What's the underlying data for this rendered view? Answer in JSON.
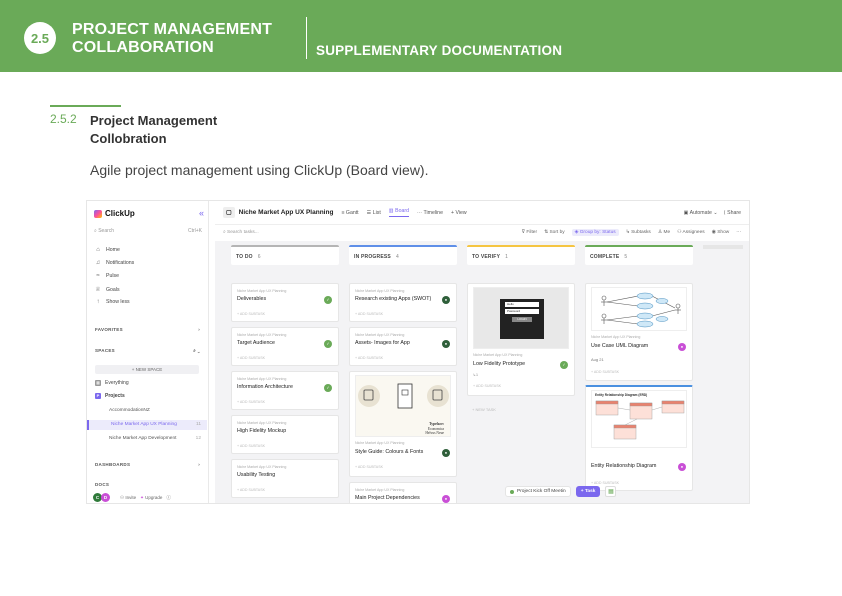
{
  "header": {
    "section_number": "2.5",
    "title_line1": "PROJECT MANAGEMENT",
    "title_line2": "COLLABORATION",
    "subtitle": "SUPPLEMENTARY DOCUMENTATION"
  },
  "subsection": {
    "number": "2.5.2",
    "title_line1": "Project Management",
    "title_line2": "Collobration",
    "description": "Agile project management using ClickUp (Board view)."
  },
  "colors": {
    "accent_green": "#6aaa58",
    "clickup_purple": "#7b68ee"
  },
  "clickup": {
    "sidebar": {
      "logo": "ClickUp",
      "search_placeholder": "Search",
      "search_shortcut": "Ctrl+K",
      "nav": [
        {
          "icon": "home-icon",
          "label": "Home"
        },
        {
          "icon": "bell-icon",
          "label": "Notifications"
        },
        {
          "icon": "pulse-icon",
          "label": "Pulse"
        },
        {
          "icon": "trophy-icon",
          "label": "Goals"
        },
        {
          "icon": "arrow-up-icon",
          "label": "Show less"
        }
      ],
      "favorites": "FAVORITES",
      "spaces": "SPACES",
      "new_space": "+ NEW SPACE",
      "everything": "Everything",
      "projects": "Projects",
      "lists": [
        {
          "label": "AccommodationNZ",
          "count": ""
        },
        {
          "label": "Niche Market App UX Planning",
          "count": "11"
        },
        {
          "label": "Niche Market App Development",
          "count": "12"
        }
      ],
      "dashboards": "DASHBOARDS",
      "docs": "DOCS",
      "invite": "Invite",
      "upgrade": "Upgrade"
    },
    "header": {
      "project": "Niche Market App UX Planning",
      "tabs": [
        "Gantt",
        "List",
        "Board",
        "Timeline",
        "+ View"
      ],
      "automate": "Automate",
      "share": "Share"
    },
    "toolbar": {
      "search_placeholder": "Search tasks...",
      "filter": "Filter",
      "sort": "Sort by",
      "group": "Group by: Status",
      "subtasks": "Subtasks",
      "me": "Me",
      "assignees": "Assignees",
      "show": "Show"
    },
    "columns": [
      {
        "name": "TO DO",
        "count": "6",
        "color": "#b5b5b5"
      },
      {
        "name": "IN PROGRESS",
        "count": "4",
        "color": "#5f8fe8"
      },
      {
        "name": "TO VERIFY",
        "count": "1",
        "color": "#f5c542"
      },
      {
        "name": "COMPLETE",
        "count": "5",
        "color": "#6aaa58"
      }
    ],
    "crumb": "Niche Market App UX Planning",
    "add_subtask": "+ ADD SUBTASK",
    "new_task": "+ NEW TASK",
    "todo_cards": [
      "Deliverables",
      "Target Audience",
      "Information Architecture",
      "High Fidelity Mockup",
      "Usability Testing"
    ],
    "progress_cards": [
      "Research existing Apps (SWOT)",
      "Assets- Images for App",
      "Style Guide: Colours & Fonts",
      "Main Project Dependencies"
    ],
    "verify_cards": [
      "Low Fidelity Prototype"
    ],
    "complete_cards": [
      "Use Case UML Diagram",
      "Entity Relationship Diagram"
    ],
    "complete_date": "Aug 21",
    "verify_subcount": "1",
    "style_guide_text": [
      "Typeface:",
      "Economica",
      "Helvus Neue"
    ],
    "prototype_labels": [
      "Hello",
      "Password",
      "LOGIN"
    ],
    "erd_title": "Entity Relationship Diagram (ERD)",
    "avatars": [
      "C",
      "D"
    ],
    "bottom": {
      "doc": "Project Kick Off Meetin",
      "task": "+ Task"
    }
  }
}
